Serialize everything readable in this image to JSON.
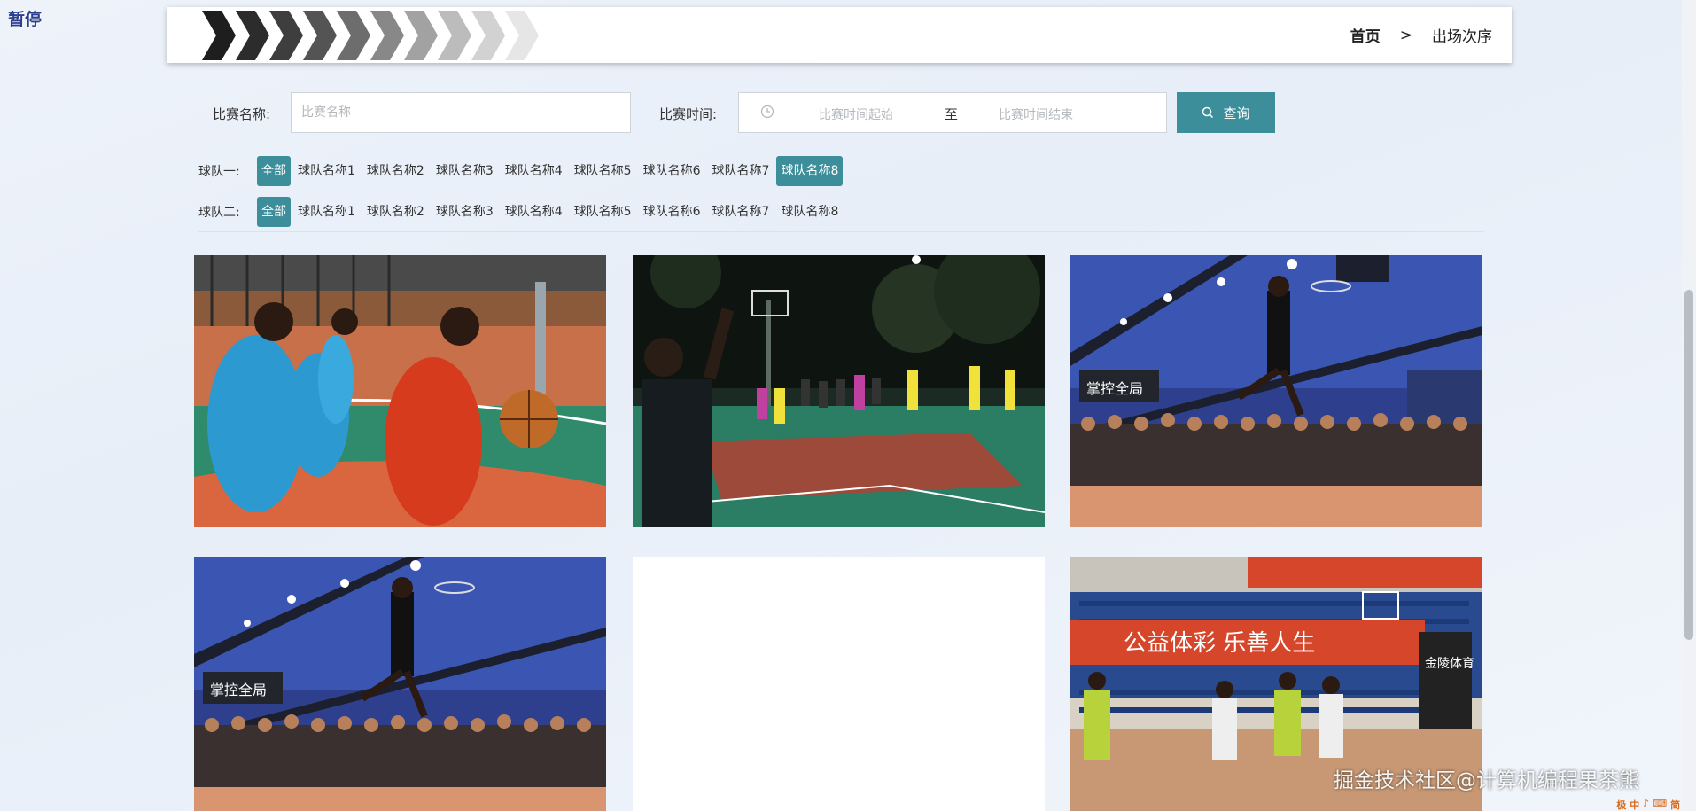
{
  "overlay": {
    "pause_label": "暂停"
  },
  "breadcrumb": {
    "home": "首页",
    "separator": ">",
    "current": "出场次序"
  },
  "search": {
    "match_name_label": "比赛名称:",
    "match_name_placeholder": "比赛名称",
    "match_time_label": "比赛时间:",
    "time_start_placeholder": "比赛时间起始",
    "time_separator": "至",
    "time_end_placeholder": "比赛时间结束",
    "query_button": "查询"
  },
  "filters": {
    "team_one": {
      "label": "球队一:",
      "options": [
        "全部",
        "球队名称1",
        "球队名称2",
        "球队名称3",
        "球队名称4",
        "球队名称5",
        "球队名称6",
        "球队名称7",
        "球队名称8"
      ],
      "active": [
        "全部",
        "球队名称8"
      ]
    },
    "team_two": {
      "label": "球队二:",
      "options": [
        "全部",
        "球队名称1",
        "球队名称2",
        "球队名称3",
        "球队名称4",
        "球队名称5",
        "球队名称6",
        "球队名称7",
        "球队名称8"
      ],
      "active": [
        "全部"
      ]
    }
  },
  "grid": {
    "items": [
      {
        "image": "basketball-players-outdoor-photo"
      },
      {
        "image": "night-court-referee-photo"
      },
      {
        "image": "dunk-crowd-night-photo"
      },
      {
        "image": "dunk-crowd-night-photo"
      },
      {
        "image": "blank-placeholder"
      },
      {
        "image": "indoor-arena-game-photo"
      }
    ],
    "arena_banner_text": "公益体彩  乐善人生",
    "arena_side_text": "金陵体育",
    "court_ad_text": "掌控全局"
  },
  "footer": {
    "watermark": "掘金技术社区@计算机编程果茶熊",
    "ime_items": [
      "极",
      "中",
      "♪",
      "⌨",
      "简",
      "⚙"
    ]
  },
  "colors": {
    "accent": "#3b8e9a",
    "header_bg": "#ffffff"
  }
}
